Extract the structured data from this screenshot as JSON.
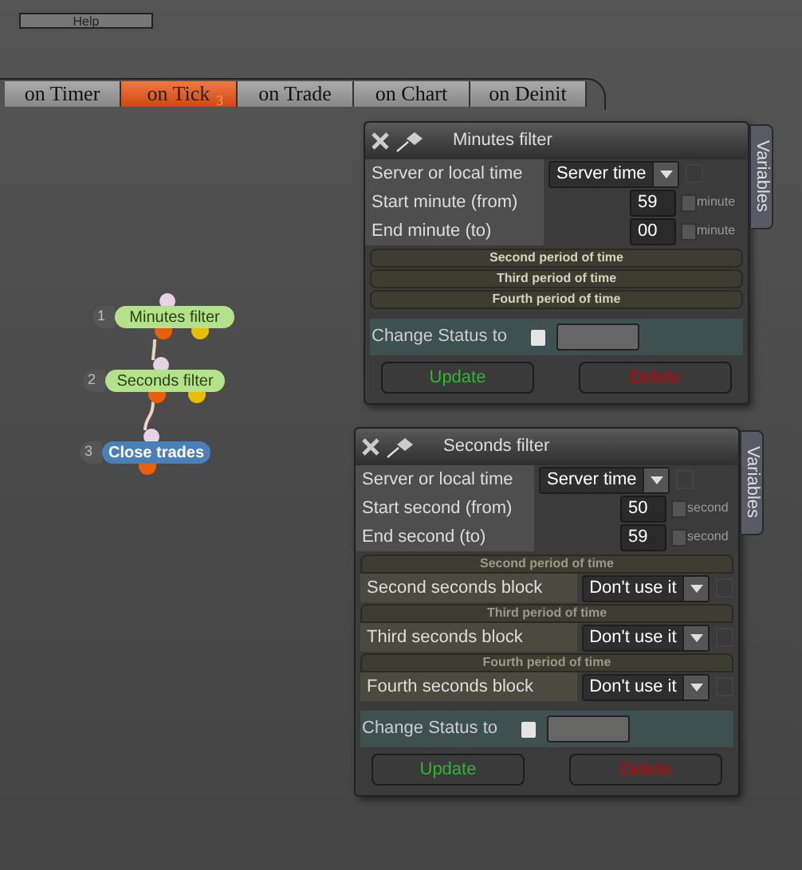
{
  "menu_button": "Help",
  "tabs": [
    {
      "label": "on Timer",
      "selected": false
    },
    {
      "label": "on Tick",
      "selected": true,
      "badge": "3"
    },
    {
      "label": "on Trade",
      "selected": false
    },
    {
      "label": "on Chart",
      "selected": false
    },
    {
      "label": "on Deinit",
      "selected": false
    }
  ],
  "nodes": [
    {
      "number": "1",
      "label": "Minutes filter",
      "kind": "filter"
    },
    {
      "number": "2",
      "label": "Seconds filter",
      "kind": "filter"
    },
    {
      "number": "3",
      "label": "Close trades",
      "kind": "action"
    }
  ],
  "panels": [
    {
      "title": "Minutes filter",
      "side_tab": "Variables",
      "fields": [
        {
          "kind": "select",
          "label": "Server or local time",
          "value": "Server time"
        },
        {
          "kind": "number",
          "label": "Start minute (from)",
          "value": "59",
          "unit": "minute",
          "checked": false
        },
        {
          "kind": "number",
          "label": "End minute (to)",
          "value": "00",
          "unit": "minute",
          "checked": false
        }
      ],
      "sections": [
        {
          "title": "Second period of time"
        },
        {
          "title": "Third period of time"
        },
        {
          "title": "Fourth period of time"
        }
      ],
      "status": {
        "label": "Change Status to",
        "checked": false
      },
      "buttons": [
        {
          "label": "Update",
          "kind": "update"
        },
        {
          "label": "Delete",
          "kind": "delete"
        }
      ]
    },
    {
      "title": "Seconds filter",
      "side_tab": "Variables",
      "fields": [
        {
          "kind": "select",
          "label": "Server or local time",
          "value": "Server time"
        },
        {
          "kind": "number",
          "label": "Start second (from)",
          "value": "50",
          "unit": "second",
          "checked": false
        },
        {
          "kind": "number",
          "label": "End second (to)",
          "value": "59",
          "unit": "second",
          "checked": false
        }
      ],
      "sections": [
        {
          "title": "Second period of time",
          "fields": [
            {
              "kind": "select",
              "label": "Second seconds block",
              "value": "Don't use it"
            }
          ]
        },
        {
          "title": "Third period of time",
          "fields": [
            {
              "kind": "select",
              "label": "Third seconds block",
              "value": "Don't use it"
            }
          ]
        },
        {
          "title": "Fourth period of time",
          "fields": [
            {
              "kind": "select",
              "label": "Fourth seconds block",
              "value": "Don't use it"
            }
          ]
        }
      ],
      "status": {
        "label": "Change Status to",
        "checked": false
      },
      "buttons": [
        {
          "label": "Update",
          "kind": "update"
        },
        {
          "label": "Delete",
          "kind": "delete"
        }
      ]
    }
  ]
}
